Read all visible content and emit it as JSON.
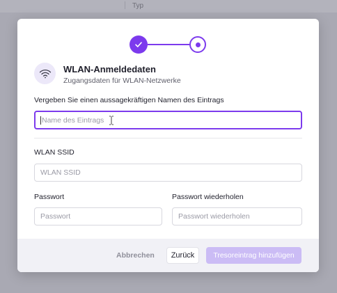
{
  "background": {
    "column_label": "Typ"
  },
  "colors": {
    "accent": "#7c3aed",
    "accent_light": "#cbbcf5",
    "icon_bg": "#ece8f9",
    "backdrop": "#a9a9b3"
  },
  "stepper": {
    "steps": [
      {
        "state": "done",
        "icon": "check-icon"
      },
      {
        "state": "current",
        "icon": "dot-icon"
      }
    ]
  },
  "entry_type": {
    "icon": "wifi-icon",
    "title": "WLAN-Anmeldedaten",
    "subtitle": "Zugangsdaten für WLAN-Netzwerke"
  },
  "form": {
    "name": {
      "label": "Vergeben Sie einen aussagekräftigen Namen des Eintrags",
      "placeholder": "Name des Eintrags",
      "value": ""
    },
    "ssid": {
      "label": "WLAN SSID",
      "placeholder": "WLAN SSID",
      "value": ""
    },
    "password": {
      "label": "Passwort",
      "placeholder": "Passwort",
      "value": ""
    },
    "password_repeat": {
      "label": "Passwort wiederholen",
      "placeholder": "Passwort wiederholen",
      "value": ""
    }
  },
  "footer": {
    "cancel_label": "Abbrechen",
    "back_label": "Zurück",
    "submit_label": "Tresoreintrag hinzufügen"
  }
}
